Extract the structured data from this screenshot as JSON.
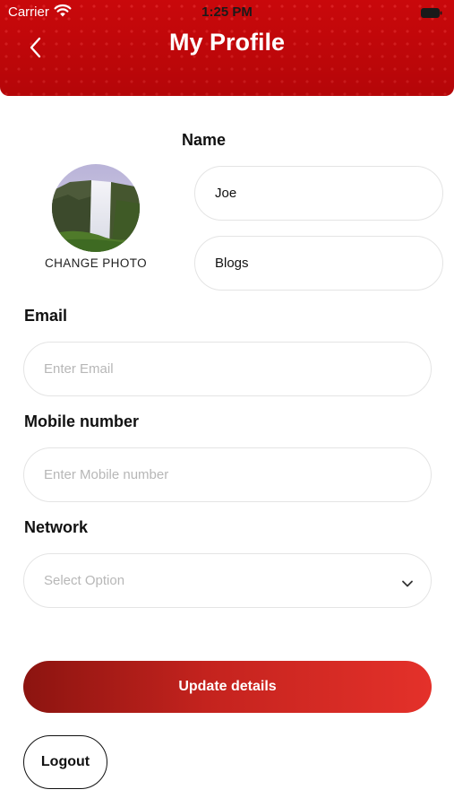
{
  "status_bar": {
    "carrier": "Carrier",
    "time": "1:25 PM"
  },
  "header": {
    "title": "My Profile"
  },
  "profile": {
    "name_label": "Name",
    "change_photo_label": "CHANGE PHOTO",
    "first_name_value": "Joe",
    "last_name_value": "Blogs"
  },
  "email": {
    "label": "Email",
    "placeholder": "Enter Email",
    "value": ""
  },
  "mobile": {
    "label": "Mobile number",
    "placeholder": "Enter Mobile number",
    "value": ""
  },
  "network": {
    "label": "Network",
    "selected_placeholder": "Select Option"
  },
  "actions": {
    "update_label": "Update details",
    "logout_label": "Logout"
  },
  "colors": {
    "brand_red": "#c9080b",
    "button_gradient_start": "#8c1410",
    "button_gradient_end": "#e4312a"
  },
  "icons": [
    "back-icon",
    "wifi-icon",
    "battery-icon",
    "chevron-down-icon"
  ]
}
